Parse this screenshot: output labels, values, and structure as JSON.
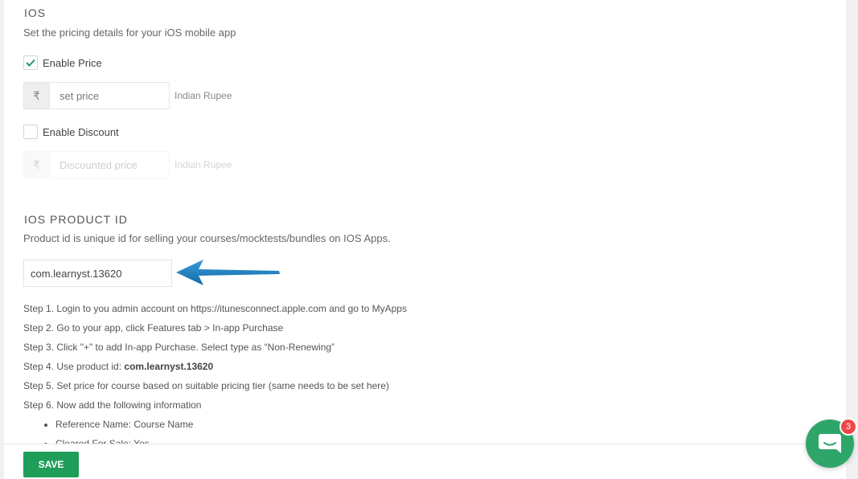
{
  "ios_pricing": {
    "title": "IOS",
    "description": "Set the pricing details for your iOS mobile app",
    "enable_price": {
      "label": "Enable Price",
      "checked": true
    },
    "price": {
      "currency_symbol": "₹",
      "placeholder": "set price",
      "currency_label": "Indian Rupee"
    },
    "enable_discount": {
      "label": "Enable Discount",
      "checked": false
    },
    "discount": {
      "currency_symbol": "₹",
      "placeholder": "Discounted price",
      "currency_label": "Indian Rupee"
    }
  },
  "ios_product_id": {
    "title": "IOS PRODUCT ID",
    "description": "Product id is unique id for selling your courses/mocktests/bundles on IOS Apps.",
    "value": "com.learnyst.13620"
  },
  "steps": {
    "step1": "Step 1. Login to you admin account on https://itunesconnect.apple.com and go to MyApps",
    "step2": "Step 2. Go to your app, click Features tab > In-app Purchase",
    "step3": "Step 3. Click \"+\" to add In-app Purchase. Select type as “Non-Renewing”",
    "step4_prefix": "Step 4. Use product id: ",
    "step4_id": "com.learnyst.13620",
    "step5": "Step 5. Set price for course based on suitable pricing tier (same needs to be set here)",
    "step6": "Step 6. Now add the following information",
    "bullets": [
      "Reference Name: Course Name",
      "Cleared For Sale: Yes"
    ]
  },
  "footer": {
    "save_label": "SAVE"
  },
  "chat": {
    "badge_count": "3",
    "icon": "chat-bubble-icon",
    "color": "#2ea66a"
  },
  "colors": {
    "accent": "#1e9e59",
    "checkmark": "#1e9e59",
    "arrow": "#1a7fc1",
    "badge": "#ef4748"
  }
}
